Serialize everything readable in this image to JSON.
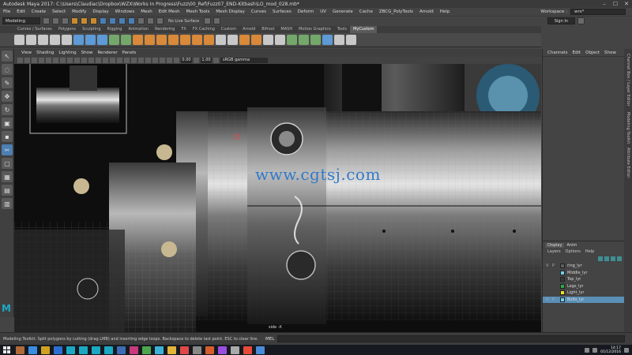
{
  "window": {
    "title": "Autodesk Maya 2017: C:\\Users\\Claudiac\\Dropbox\\WZX\\Works In Progress\\Fuzz\\00_Ref\\Fuzz07_END-Kitbash\\LO_mod_028.mb*",
    "controls": [
      "–",
      "☐",
      "✕"
    ]
  },
  "menubar": {
    "items": [
      "File",
      "Edit",
      "Create",
      "Select",
      "Modify",
      "Display",
      "Windows",
      "Mesh",
      "Edit Mesh",
      "Mesh Tools",
      "Mesh Display",
      "Curves",
      "Surfaces",
      "Deform",
      "UV",
      "Generate",
      "Cache",
      "ZBCG_PolyTools",
      "Arnold",
      "Help"
    ],
    "workspace_label": "Workspace :",
    "workspace_value": "wrs*"
  },
  "statusline": {
    "mode": "Modeling",
    "live_surface": "No Live Surface",
    "sign_in": "Sign In"
  },
  "shelf": {
    "tabs": [
      "Curves / Surfaces",
      "Polygons",
      "Sculpting",
      "Rigging",
      "Animation",
      "Rendering",
      "FX",
      "FX Caching",
      "Custom",
      "Arnold",
      "Bifrost",
      "MASH",
      "Motion Graphics",
      "Tools",
      "MyCustom"
    ],
    "active_tab": "MyCustom"
  },
  "panel": {
    "menu": [
      "View",
      "Shading",
      "Lighting",
      "Show",
      "Renderer",
      "Panels"
    ],
    "field_a": "0.00",
    "field_b": "1.00",
    "color_space": "sRGB gamma",
    "camera_label": "side -X"
  },
  "watermark": "www.cgtsj.com",
  "channelbox": {
    "tabs": [
      "Channels",
      "Edit",
      "Object",
      "Show"
    ]
  },
  "side_tabs": [
    "Channel Box / Layer Editor",
    "Modeling Toolkit",
    "Attribute Editor"
  ],
  "layers": {
    "tabs": [
      "Display",
      "Anim"
    ],
    "active_tab": "Display",
    "menu": [
      "Layers",
      "Options",
      "Help"
    ],
    "items": [
      {
        "name": "ring_lyr",
        "color": "#5e5e5e",
        "v": "V",
        "p": "P",
        "selected": false
      },
      {
        "name": "Middle_lyr",
        "color": "#6fd0e8",
        "v": "",
        "p": "",
        "selected": false
      },
      {
        "name": "Top_lyr",
        "color": "#3a3a3a",
        "v": "",
        "p": "",
        "selected": false
      },
      {
        "name": "Legs_lyr",
        "color": "#2fa84a",
        "v": "",
        "p": "",
        "selected": false
      },
      {
        "name": "Light_lyr",
        "color": "#f2e22a",
        "v": "",
        "p": "",
        "selected": false
      },
      {
        "name": "Bolts_lyr",
        "color": "#6fd0e8",
        "v": "V",
        "p": "P",
        "selected": true
      }
    ]
  },
  "helpline": {
    "text": "Modeling Toolkit: Split polygons by cutting (drag LMB) and inserting edge loops. Backspace to delete last point. ESC to clear line.",
    "mel_label": "MEL"
  },
  "taskbar": {
    "time": "14:17",
    "date": "01/12/2016",
    "app_colors": [
      "#b06a3a",
      "#3a8de0",
      "#d0a020",
      "#2b6fd1",
      "#1ba8c3",
      "#1ba8c3",
      "#1ba8c3",
      "#1ba8c3",
      "#3c6cb5",
      "#c93a7a",
      "#4da64d",
      "#3bb3d8",
      "#e0b53a",
      "#e04848",
      "#888888",
      "#d85d2c",
      "#9a4de0",
      "#aaaaaa",
      "#e84a3a",
      "#4a8ad8"
    ]
  }
}
